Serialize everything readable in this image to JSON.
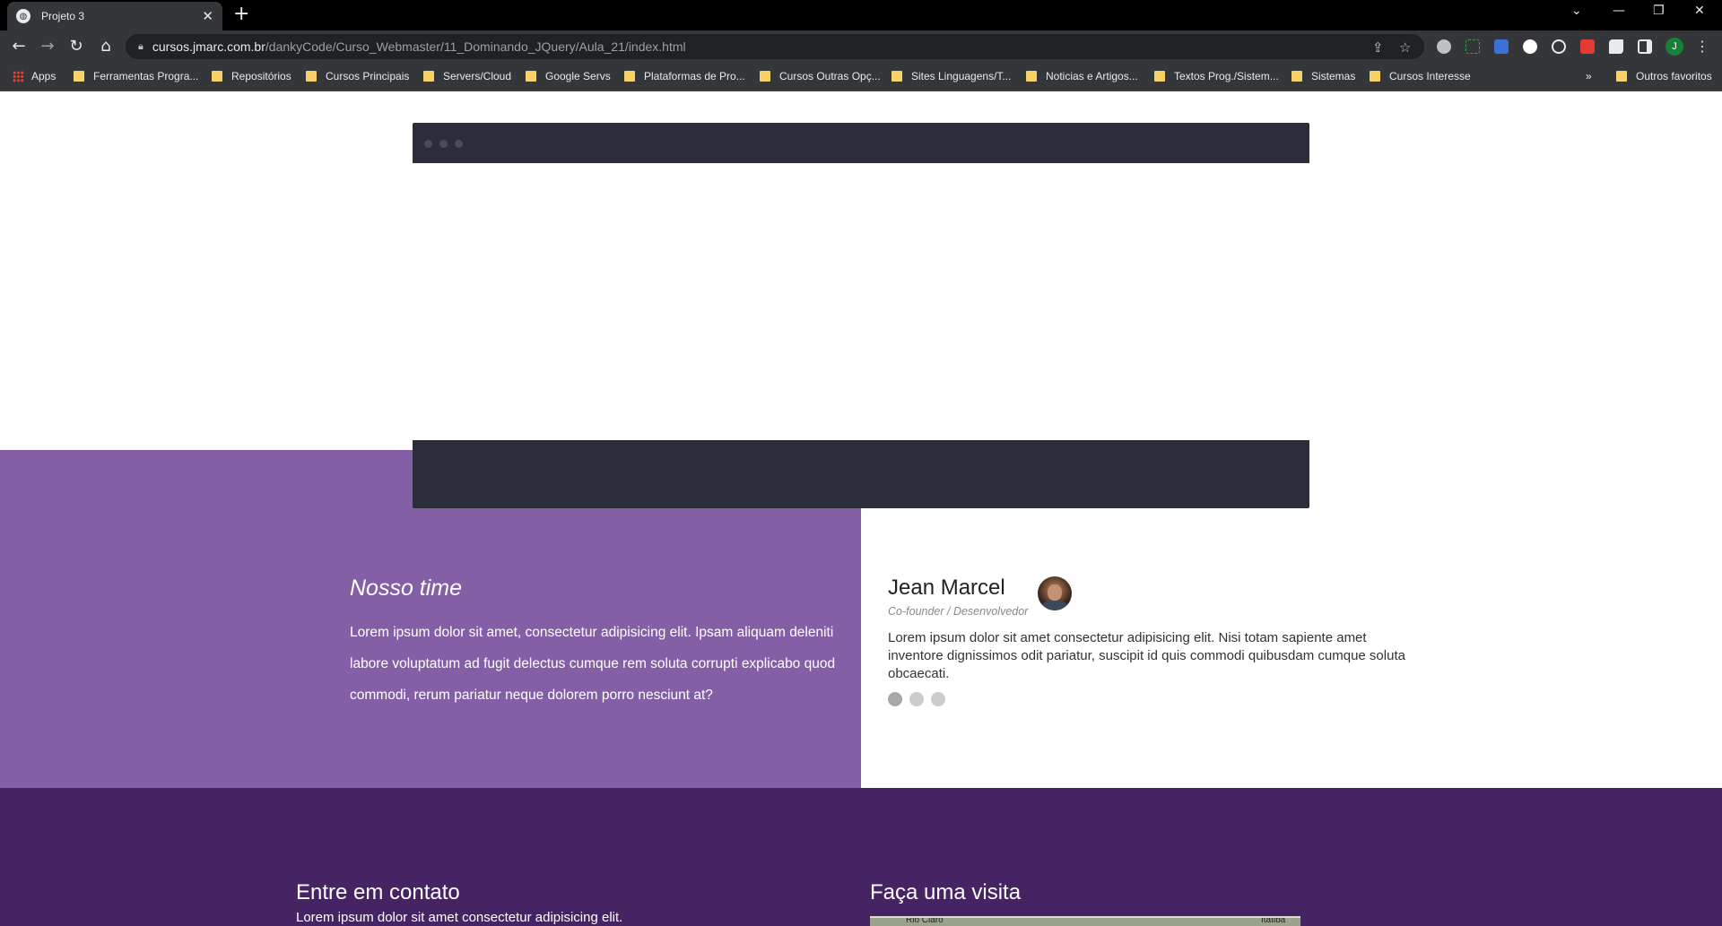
{
  "browser": {
    "tab_title": "Projeto 3",
    "new_tab": "+",
    "url_host": "cursos.jmarc.com.br",
    "url_path": "/dankyCode/Curso_Webmaster/11_Dominando_JQuery/Aula_21/index.html",
    "profile_initial": "J",
    "bookmarks": [
      "Apps",
      "Ferramentas Progra...",
      "Repositórios",
      "Cursos Principais",
      "Servers/Cloud",
      "Google Servs",
      "Plataformas de Pro...",
      "Cursos Outras Opç...",
      "Sites Linguagens/T...",
      "Noticias e Artigos...",
      "Textos Prog./Sistem...",
      "Sistemas",
      "Cursos Interesse"
    ],
    "more_bookmarks": "»",
    "other_bookmarks": "Outros favoritos"
  },
  "team": {
    "title": "Nosso time",
    "text": "Lorem ipsum dolor sit amet, consectetur adipisicing elit. Ipsam aliquam deleniti labore voluptatum ad fugit delectus cumque rem soluta corrupti explicabo quod commodi, rerum pariatur neque dolorem porro nesciunt at?"
  },
  "member": {
    "name": "Jean Marcel",
    "role": "Co-founder / Desenvolvedor",
    "text": "Lorem ipsum dolor sit amet consectetur adipisicing elit. Nisi totam sapiente amet inventore dignissimos odit pariatur, suscipit id quis commodi quibusdam cumque soluta obcaecati."
  },
  "contact": {
    "title": "Entre em contato",
    "text": "Lorem ipsum dolor sit amet consectetur adipisicing elit.",
    "visit_title": "Faça uma visita",
    "map_label_left": "Rio Claro",
    "map_label_right": "Itatiba"
  },
  "colors": {
    "purple_light": "#845fa6",
    "purple_dark": "#462464",
    "mockup_dark": "#2b2d3a"
  }
}
